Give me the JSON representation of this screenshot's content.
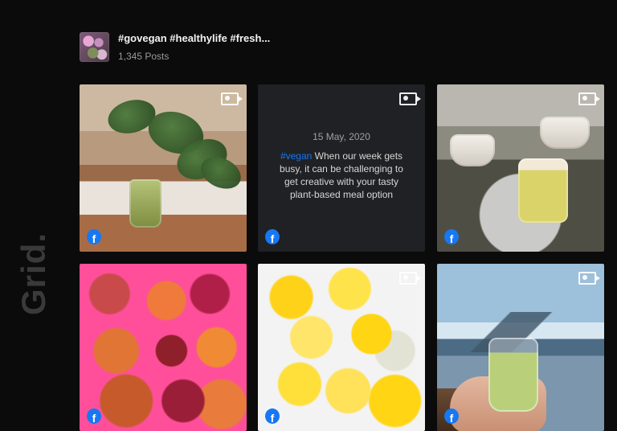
{
  "header": {
    "title": "#govegan #healthylife #fresh...",
    "posts_count": "1,345 Posts"
  },
  "brand": {
    "text": "Grid."
  },
  "posts": [
    {
      "type": "image",
      "source_icon": "facebook-icon",
      "media_icon": "video-camera-icon",
      "fb_letter": "f"
    },
    {
      "type": "text",
      "source_icon": "facebook-icon",
      "media_icon": "video-camera-icon",
      "fb_letter": "f",
      "date": "15 May, 2020",
      "hashtag": "#vegan",
      "text": " When our week gets busy, it can be challenging to get creative with your tasty plant-based meal option"
    },
    {
      "type": "image",
      "source_icon": "facebook-icon",
      "media_icon": "video-camera-icon",
      "fb_letter": "f"
    },
    {
      "type": "image",
      "source_icon": "facebook-icon",
      "media_icon": "video-camera-icon",
      "fb_letter": "f"
    },
    {
      "type": "image",
      "source_icon": "facebook-icon",
      "media_icon": "video-camera-icon",
      "fb_letter": "f"
    },
    {
      "type": "image",
      "source_icon": "facebook-icon",
      "media_icon": "video-camera-icon",
      "fb_letter": "f"
    }
  ],
  "colors": {
    "background": "#0b0b0b",
    "facebook_blue": "#1877f2",
    "card_dark": "#1f2124"
  }
}
